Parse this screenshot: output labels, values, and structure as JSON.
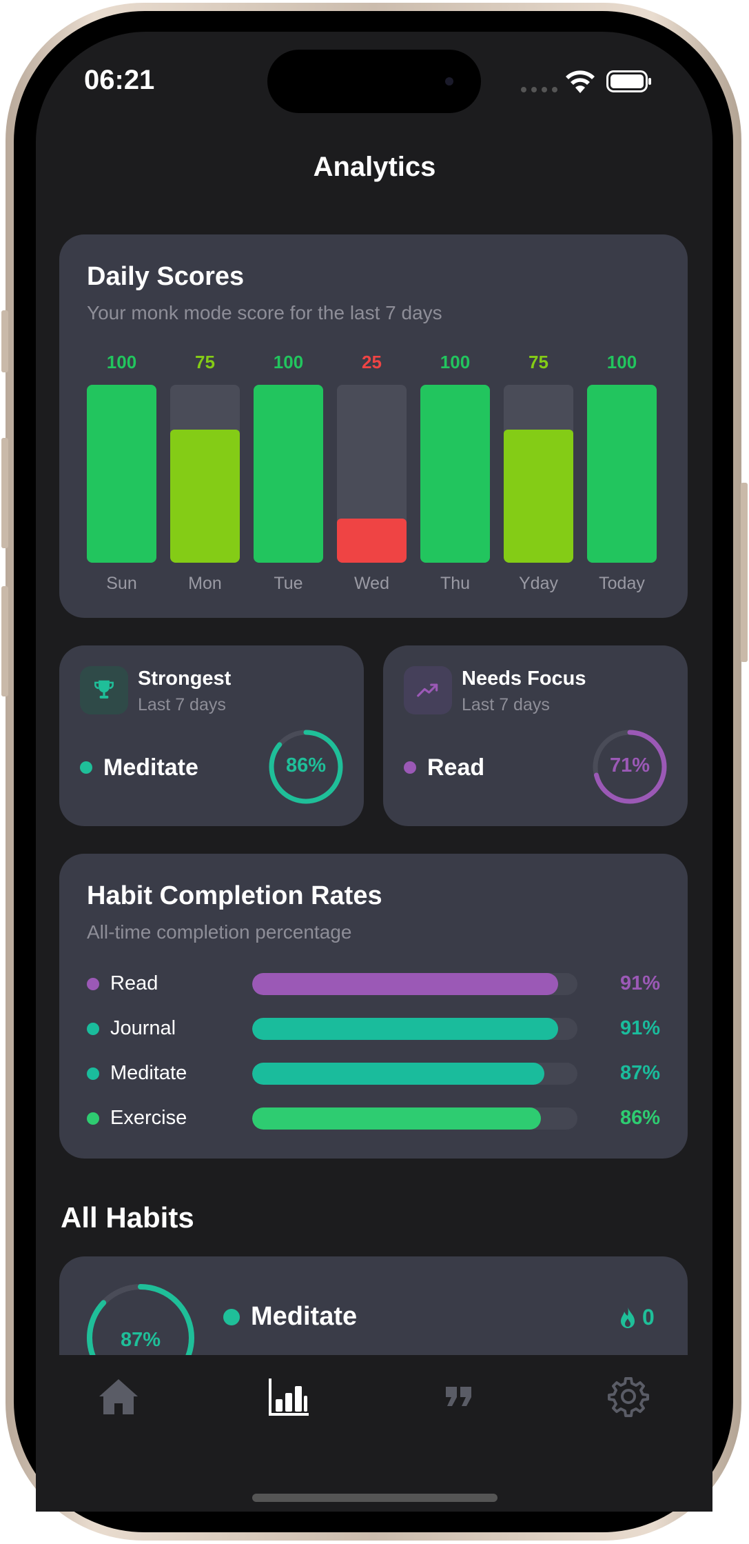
{
  "status": {
    "time": "06:21"
  },
  "nav": {
    "title": "Analytics"
  },
  "daily_scores": {
    "title": "Daily Scores",
    "subtitle": "Your monk mode score for the last 7 days"
  },
  "chart_data": {
    "type": "bar",
    "categories": [
      "Sun",
      "Mon",
      "Tue",
      "Wed",
      "Thu",
      "Yday",
      "Today"
    ],
    "values": [
      100,
      75,
      100,
      25,
      100,
      75,
      100
    ],
    "value_labels": [
      "100",
      "75",
      "100",
      "25",
      "100",
      "75",
      "100"
    ],
    "ylim": [
      0,
      100
    ],
    "colors": {
      "high": "#22c55e",
      "mid": "#84cc16",
      "low": "#ef4444",
      "track": "#4a4c58"
    }
  },
  "strongest": {
    "title": "Strongest",
    "subtitle": "Last 7 days",
    "icon": "trophy-icon",
    "habit": "Meditate",
    "percent_label": "86%",
    "percent": 86,
    "color": "#1fbf99"
  },
  "needs_focus": {
    "title": "Needs Focus",
    "subtitle": "Last 7 days",
    "icon": "trend-up-icon",
    "habit": "Read",
    "percent_label": "71%",
    "percent": 71,
    "color": "#9b59b6"
  },
  "completion": {
    "title": "Habit Completion Rates",
    "subtitle": "All-time completion percentage",
    "rows": [
      {
        "name": "Read",
        "pct_label": "91%",
        "pct": 91,
        "color": "#9b59b6"
      },
      {
        "name": "Journal",
        "pct_label": "91%",
        "pct": 91,
        "color": "#1abc9c"
      },
      {
        "name": "Meditate",
        "pct_label": "87%",
        "pct": 87,
        "color": "#1abc9c"
      },
      {
        "name": "Exercise",
        "pct_label": "86%",
        "pct": 86,
        "color": "#2ecc71"
      }
    ]
  },
  "all_habits": {
    "title": "All Habits",
    "items": [
      {
        "name": "Meditate",
        "percent_label": "87%",
        "percent": 87,
        "streak": "0",
        "color": "#1fbf99"
      }
    ]
  },
  "tabbar": {
    "tabs": [
      {
        "name": "home",
        "icon": "house-icon",
        "active": false
      },
      {
        "name": "analytics",
        "icon": "bar-chart-icon",
        "active": true
      },
      {
        "name": "quotes",
        "icon": "quote-icon",
        "active": false
      },
      {
        "name": "settings",
        "icon": "gear-icon",
        "active": false
      }
    ]
  }
}
